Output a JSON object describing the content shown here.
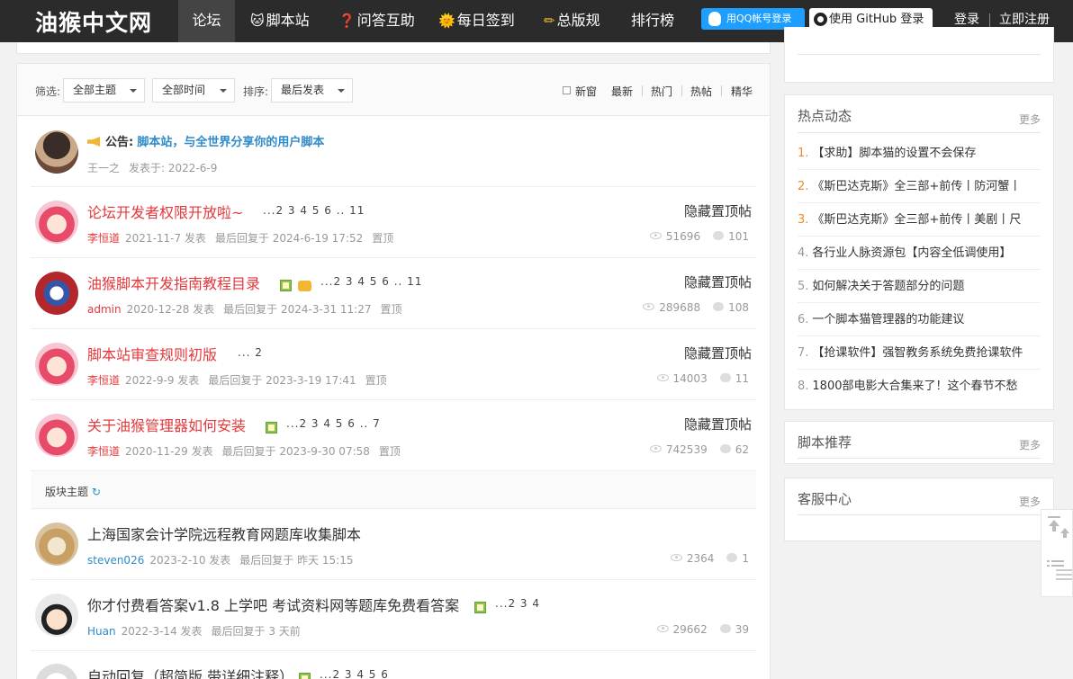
{
  "nav": {
    "logo": "油猴中文网",
    "items": [
      {
        "label": "论坛",
        "icon": "",
        "active": true
      },
      {
        "label": "脚本站",
        "icon": "🐱"
      },
      {
        "label": "问答互助",
        "icon": "❓"
      },
      {
        "label": "每日签到",
        "icon": "🌞"
      },
      {
        "label": "总版规",
        "icon": "✏"
      },
      {
        "label": "排行榜",
        "icon": ""
      }
    ],
    "qq_login": "用QQ帐号登录",
    "github_login": "使用 GitHub 登录",
    "login": "登录",
    "register": "立即注册"
  },
  "filter": {
    "label": "筛选:",
    "topic_select": "全部主题",
    "time_select": "全部时间",
    "sort_label": "排序:",
    "sort_select": "最后发表",
    "new_window": "新窗",
    "links": [
      "最新",
      "热门",
      "热帖",
      "精华"
    ]
  },
  "announcement": {
    "label": "公告:",
    "title": "脚本站，与全世界分享你的用户脚本",
    "author": "王一之",
    "posted": "发表于: 2022-6-9"
  },
  "pinned": [
    {
      "title": "论坛开发者权限开放啦~",
      "pages": "...2 3 4 5 6 .. 11",
      "author": "李恒道",
      "date": "2021-11-7 发表",
      "last_reply": "最后回复于 2024-6-19 17:52",
      "tag": "置顶",
      "pin_label": "隐藏置顶帖",
      "views": "51696",
      "replies": "101"
    },
    {
      "title": "油猴脚本开发指南教程目录",
      "pages": "...2 3 4 5 6 .. 11",
      "author": "admin",
      "date": "2020-12-28 发表",
      "last_reply": "最后回复于 2024-3-31 11:27",
      "tag": "置顶",
      "pin_label": "隐藏置顶帖",
      "views": "289688",
      "replies": "108"
    },
    {
      "title": "脚本站审查规则初版",
      "pages": "... 2",
      "author": "李恒道",
      "date": "2022-9-9 发表",
      "last_reply": "最后回复于 2023-3-19 17:41",
      "tag": "置顶",
      "pin_label": "隐藏置顶帖",
      "views": "14003",
      "replies": "11"
    },
    {
      "title": "关于油猴管理器如何安装",
      "pages": "...2 3 4 5 6 .. 7",
      "author": "李恒道",
      "date": "2020-11-29 发表",
      "last_reply": "最后回复于 2023-9-30 07:58",
      "tag": "置顶",
      "pin_label": "隐藏置顶帖",
      "views": "742539",
      "replies": "62"
    }
  ],
  "section_title": "版块主题",
  "threads": [
    {
      "title": "上海国家会计学院远程教育网题库收集脚本",
      "pages": "",
      "author": "steven026",
      "date": "2023-2-10 发表",
      "last_reply": "最后回复于 昨天 15:15",
      "views": "2364",
      "replies": "1"
    },
    {
      "title": "你才付费看答案v1.8 上学吧 考试资料网等题库免费看答案",
      "pages": "...2 3 4",
      "author": "Huan",
      "date": "2022-3-14 发表",
      "last_reply": "最后回复于 3 天前",
      "views": "29662",
      "replies": "39"
    },
    {
      "title": "自动回复（超简版,带详细注释）",
      "pages": "...2 3 4 5 6",
      "author": "",
      "date": "",
      "last_reply": "",
      "views": "",
      "replies": ""
    }
  ],
  "sidebar": {
    "hot_title": "热点动态",
    "more": "更多",
    "hot_items": [
      {
        "num": "1.",
        "text": "【求助】脚本猫的设置不会保存"
      },
      {
        "num": "2.",
        "text": "《斯巴达克斯》全三部+前传丨防河蟹丨"
      },
      {
        "num": "3.",
        "text": "《斯巴达克斯》全三部+前传丨美剧丨尺"
      },
      {
        "num": "4.",
        "text": "各行业人脉资源包【内容全低调使用】"
      },
      {
        "num": "5.",
        "text": "如何解决关于答题部分的问题"
      },
      {
        "num": "6.",
        "text": "一个脚本猫管理器的功能建议"
      },
      {
        "num": "7.",
        "text": "【抢课软件】强智教务系统免费抢课软件"
      },
      {
        "num": "8.",
        "text": "1800部电影大合集来了！这个春节不愁"
      }
    ],
    "script_title": "脚本推荐",
    "service_title": "客服中心"
  },
  "colors": {
    "nav_bg": "#2b2b2b",
    "accent_red": "#e5383b",
    "link_blue": "#2e8bc9",
    "qq_blue": "#1e9fff",
    "hot_orange": "#f08a24"
  }
}
